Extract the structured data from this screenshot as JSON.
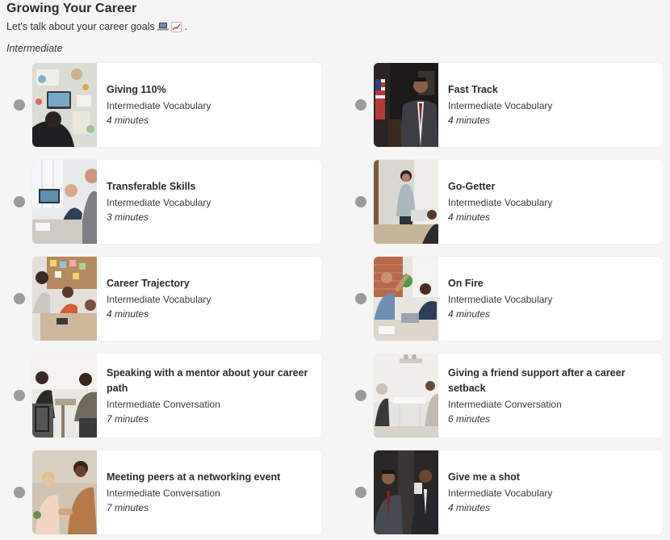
{
  "header": {
    "title": "Growing Your Career",
    "subtitle": "Let's talk about your career goals",
    "subtitle_emojis": [
      "laptop-emoji",
      "chart-increasing-emoji"
    ],
    "subtitle_end": ".",
    "level": "Intermediate"
  },
  "lessons": [
    {
      "title": "Giving 110%",
      "type": "Intermediate Vocabulary",
      "duration": "4 minutes",
      "image": "desk-overhead-photo"
    },
    {
      "title": "Fast Track",
      "type": "Intermediate Vocabulary",
      "duration": "4 minutes",
      "image": "businessman-flag-photo"
    },
    {
      "title": "Transferable Skills",
      "type": "Intermediate Vocabulary",
      "duration": "3 minutes",
      "image": "office-meeting-photo"
    },
    {
      "title": "Go-Getter",
      "type": "Intermediate Vocabulary",
      "duration": "4 minutes",
      "image": "presenter-whiteboard-photo"
    },
    {
      "title": "Career Trajectory",
      "type": "Intermediate Vocabulary",
      "duration": "4 minutes",
      "image": "team-table-photo"
    },
    {
      "title": "On Fire",
      "type": "Intermediate Vocabulary",
      "duration": "4 minutes",
      "image": "high-five-office-photo"
    },
    {
      "title": "Speaking with a mentor about your career path",
      "type": "Intermediate Conversation",
      "duration": "7 minutes",
      "image": "mentor-conversation-photo"
    },
    {
      "title": "Giving a friend support after a career setback",
      "type": "Intermediate Conversation",
      "duration": "6 minutes",
      "image": "friends-talking-photo"
    },
    {
      "title": "Meeting peers at a networking event",
      "type": "Intermediate Conversation",
      "duration": "7 minutes",
      "image": "networking-handshake-photo"
    },
    {
      "title": "Give me a shot",
      "type": "Intermediate Vocabulary",
      "duration": "4 minutes",
      "image": "businessmen-talking-photo"
    }
  ]
}
